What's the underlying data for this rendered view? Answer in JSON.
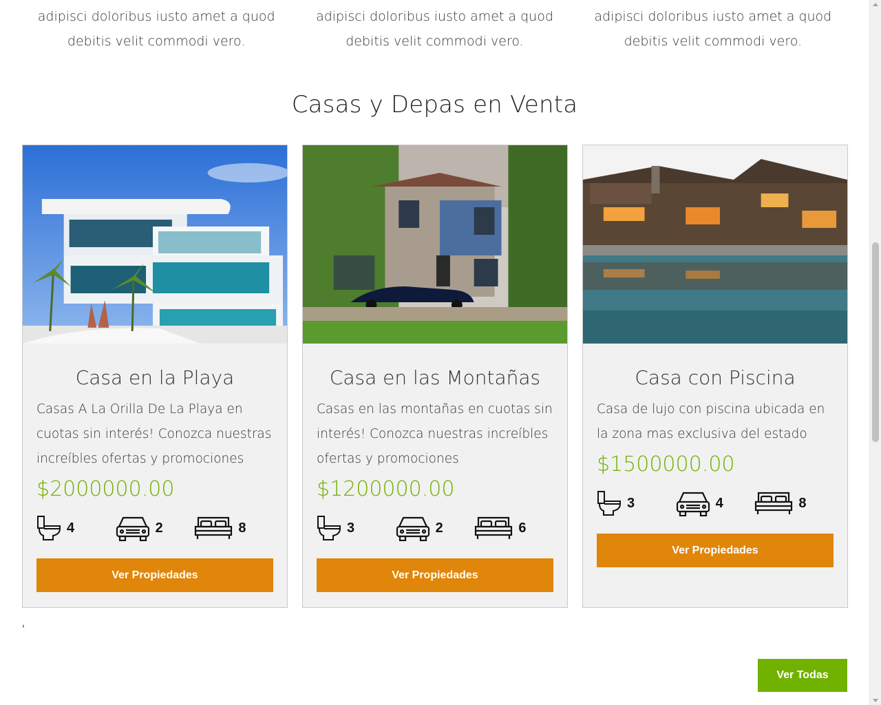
{
  "intro": {
    "columns": [
      {
        "text": "adipisci doloribus iusto amet a quod debitis velit commodi vero."
      },
      {
        "text": "adipisci doloribus iusto amet a quod debitis velit commodi vero."
      },
      {
        "text": "adipisci doloribus iusto amet a quod debitis velit commodi vero."
      }
    ]
  },
  "section": {
    "title": "Casas y Depas en Venta"
  },
  "cards": [
    {
      "title": "Casa en la Playa",
      "description": "Casas A La Orilla De La Playa en cuotas sin interés! Conozca nuestras increíbles ofertas y promociones",
      "price": "$2000000.00",
      "bathrooms": "4",
      "parking": "2",
      "bedrooms": "8",
      "button": "Ver Propiedades",
      "image_icon": "beach-house-photo"
    },
    {
      "title": "Casa en las Montañas",
      "description": "Casas en las montañas en cuotas sin interés! Conozca nuestras increíbles ofertas y promociones",
      "price": "$1200000.00",
      "bathrooms": "3",
      "parking": "2",
      "bedrooms": "6",
      "button": "Ver Propiedades",
      "image_icon": "mountain-house-photo"
    },
    {
      "title": "Casa con Piscina",
      "description": "Casa de lujo con piscina ubicada en la zona mas exclusiva del estado",
      "price": "$1500000.00",
      "bathrooms": "3",
      "parking": "4",
      "bedrooms": "8",
      "button": "Ver Propiedades",
      "image_icon": "pool-house-photo"
    }
  ],
  "stray_text": "'",
  "footer": {
    "view_all": "Ver Todas"
  },
  "colors": {
    "accent_orange": "#e0860a",
    "accent_green": "#71b100",
    "card_bg": "#f1f1f1"
  },
  "icons": {
    "bathroom": "toilet-icon",
    "parking": "car-icon",
    "bedroom": "bed-icon"
  }
}
